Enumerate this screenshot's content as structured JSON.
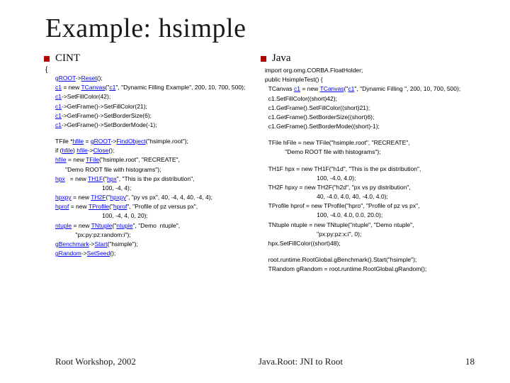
{
  "slide": {
    "title": "Example: hsimple",
    "left": {
      "heading": "CINT",
      "openBrace": "{",
      "block1": [
        "<a>gROOT</a>-&gt;<a>Reset</a>();",
        "<a>c1</a> = new <a>TCanvas</a>(\"<a>c1</a>\", \"Dynamic Filling Example\", 200, 10, 700, 500);",
        "<a>c1</a>-&gt;SetFillColor(42);",
        "<a>c1</a>-&gt;GetFrame()-&gt;SetFillColor(21);",
        "<a>c1</a>-&gt;GetFrame()-&gt;SetBorderSize(6);",
        "<a>c1</a>-&gt;GetFrame()-&gt;SetBorderMode(-1);"
      ],
      "block2": [
        "TFile *<a>hfile</a> = <a>gROOT</a>-&gt;<a>FindObject</a>(\"hsimple.root\");",
        "if (<a>hfile</a>) <a>hfile</a>-&gt;<a>Close</a>();",
        "<a>hfile</a> = new <a>TFile</a>(\"hsimple.root\", \"RECREATE\",",
        "&nbsp;&nbsp;&nbsp;&nbsp;&nbsp;&nbsp;\"Demo ROOT file with histograms\");",
        "<a>hpx</a>&nbsp;&nbsp;&nbsp;= new <a>TH1F</a>(\"<a>hpx</a>\", \"This is the px distribution\",",
        "&nbsp;&nbsp;&nbsp;&nbsp;&nbsp;&nbsp;&nbsp;&nbsp;&nbsp;&nbsp;&nbsp;&nbsp;&nbsp;&nbsp;&nbsp;&nbsp;&nbsp;&nbsp;&nbsp;&nbsp;&nbsp;&nbsp;&nbsp;&nbsp;&nbsp;&nbsp;&nbsp;&nbsp;100, -4, 4);",
        "<a>hpxpy</a> = new <a>TH2F</a>(\"<a>hpxpy</a>\", \"py vs px\", 40, -4, 4, 40, -4, 4);",
        "<a>hprof</a>&nbsp;= new <a>TProfile</a>(\"<a>hprof</a>\", \"Profile of pz versus px\",",
        "&nbsp;&nbsp;&nbsp;&nbsp;&nbsp;&nbsp;&nbsp;&nbsp;&nbsp;&nbsp;&nbsp;&nbsp;&nbsp;&nbsp;&nbsp;&nbsp;&nbsp;&nbsp;&nbsp;&nbsp;&nbsp;&nbsp;&nbsp;&nbsp;&nbsp;&nbsp;&nbsp;&nbsp;100, -4, 4, 0, 20);",
        "<a>ntuple</a> = new <a>TNtuple</a>(\"<a>ntuple</a>\", \"Demo&nbsp;&nbsp;ntuple\",",
        "&nbsp;&nbsp;&nbsp;&nbsp;&nbsp;&nbsp;&nbsp;&nbsp;&nbsp;&nbsp;&nbsp;&nbsp;\"px:py:pz:random:i\");",
        "<a>gBenchmark</a>-&gt;<a>Start</a>(\"hsimple\");",
        "<a>gRandom</a>-&gt;<a>SetSeed</a>();"
      ]
    },
    "right": {
      "heading": "Java",
      "block1": [
        "import org.omg.CORBA.FloatHolder;",
        "public HsimpleTest() {",
        "&nbsp;&nbsp;TCanvas <a>c1</a> = new <a>TCanvas</a>(\"<a>c1</a>\", \"Dynamic Filling \", 200, 10, 700, 500);",
        "&nbsp;&nbsp;c1.SetFillColor((short)42);",
        "&nbsp;&nbsp;c1.GetFrame().SetFillColor((short)21);",
        "&nbsp;&nbsp;c1.GetFrame().SetBorderSize((short)6);",
        "&nbsp;&nbsp;c1.GetFrame().SetBorderMode((short)-1);"
      ],
      "block2": [
        "&nbsp;&nbsp;TFile hFile = new TFile(\"hsimple.root\", \"RECREATE\",",
        "&nbsp;&nbsp;&nbsp;&nbsp;&nbsp;&nbsp;&nbsp;&nbsp;&nbsp;&nbsp;&nbsp;&nbsp;\"Demo ROOT file with histograms\");"
      ],
      "block3": [
        "&nbsp;&nbsp;TH1F hpx&nbsp;= new TH1F(\"h1d\", \"This is the px  distribution\",",
        "&nbsp;&nbsp;&nbsp;&nbsp;&nbsp;&nbsp;&nbsp;&nbsp;&nbsp;&nbsp;&nbsp;&nbsp;&nbsp;&nbsp;&nbsp;&nbsp;&nbsp;&nbsp;&nbsp;&nbsp;&nbsp;&nbsp;&nbsp;&nbsp;&nbsp;&nbsp;&nbsp;&nbsp;&nbsp;&nbsp;&nbsp;100, -4.0, 4.0);",
        "&nbsp;&nbsp;TH2F hpxy = new TH2F(\"h2d\", \"px vs py distribution\",",
        "&nbsp;&nbsp;&nbsp;&nbsp;&nbsp;&nbsp;&nbsp;&nbsp;&nbsp;&nbsp;&nbsp;&nbsp;&nbsp;&nbsp;&nbsp;&nbsp;&nbsp;&nbsp;&nbsp;&nbsp;&nbsp;&nbsp;&nbsp;&nbsp;&nbsp;&nbsp;&nbsp;&nbsp;&nbsp;&nbsp;&nbsp;40, -4.0, 4.0, 40, -4.0, 4.0);",
        "&nbsp;&nbsp;TProfile&nbsp;hprof = new TProfile(\"hpro\", \"Profile of pz vs px\",",
        "&nbsp;&nbsp;&nbsp;&nbsp;&nbsp;&nbsp;&nbsp;&nbsp;&nbsp;&nbsp;&nbsp;&nbsp;&nbsp;&nbsp;&nbsp;&nbsp;&nbsp;&nbsp;&nbsp;&nbsp;&nbsp;&nbsp;&nbsp;&nbsp;&nbsp;&nbsp;&nbsp;&nbsp;&nbsp;&nbsp;&nbsp;100, -4.0, 4.0, 0.0, 20.0);",
        "&nbsp;&nbsp;TNtuple ntuple = new TNtuple(\"ntuple\", \"Demo ntuple\",",
        "&nbsp;&nbsp;&nbsp;&nbsp;&nbsp;&nbsp;&nbsp;&nbsp;&nbsp;&nbsp;&nbsp;&nbsp;&nbsp;&nbsp;&nbsp;&nbsp;&nbsp;&nbsp;&nbsp;&nbsp;&nbsp;&nbsp;&nbsp;&nbsp;&nbsp;&nbsp;&nbsp;&nbsp;&nbsp;&nbsp;&nbsp;\"px:py:pz:x:i\", 0);",
        "&nbsp;&nbsp;hpx.SetFillColor((short)48);"
      ],
      "block4": [
        "&nbsp;&nbsp;root.runtime.RootGlobal.gBenchmark().Start(\"hsimple\");",
        "&nbsp;&nbsp;TRandom gRandom = root.runtime.RootGlobal.gRandom();"
      ]
    },
    "footer": {
      "left": "Root Workshop, 2002",
      "center": "Java.Root: JNI to Root",
      "pageNum": "18"
    }
  }
}
